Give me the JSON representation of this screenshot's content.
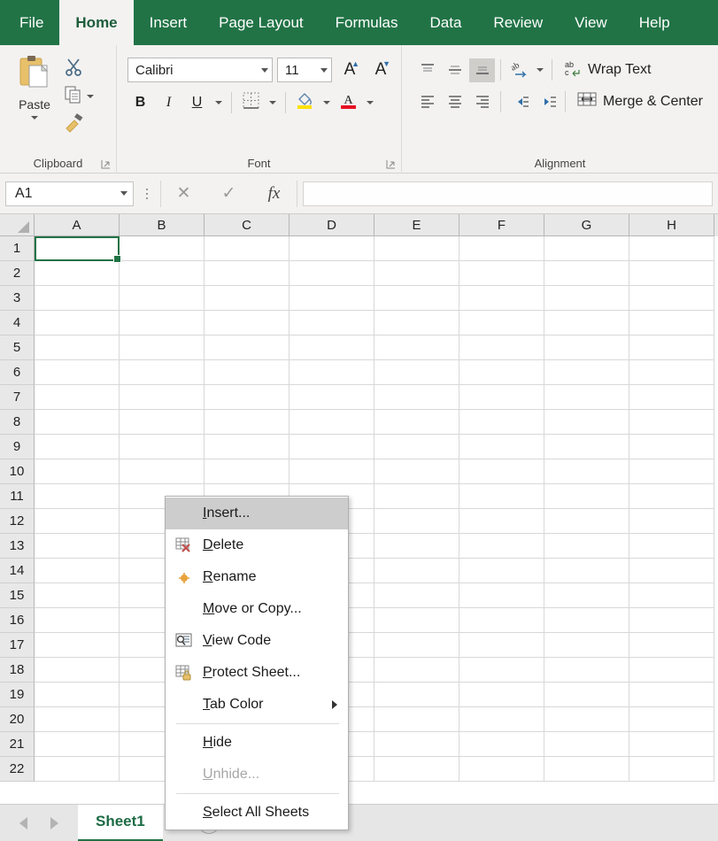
{
  "ribbon": {
    "tabs": [
      {
        "label": "File",
        "active": false
      },
      {
        "label": "Home",
        "active": true
      },
      {
        "label": "Insert",
        "active": false
      },
      {
        "label": "Page Layout",
        "active": false
      },
      {
        "label": "Formulas",
        "active": false
      },
      {
        "label": "Data",
        "active": false
      },
      {
        "label": "Review",
        "active": false
      },
      {
        "label": "View",
        "active": false
      },
      {
        "label": "Help",
        "active": false
      }
    ],
    "groups": {
      "clipboard": {
        "label": "Clipboard",
        "paste_label": "Paste",
        "icons": [
          "paste-clipboard-icon",
          "cut-scissors-icon",
          "copy-icon",
          "format-painter-icon"
        ]
      },
      "font": {
        "label": "Font",
        "font_name": "Calibri",
        "font_size": "11",
        "grow_font": "A",
        "shrink_font": "A",
        "bold": "B",
        "italic": "I",
        "underline": "U"
      },
      "alignment": {
        "label": "Alignment",
        "wrap_text": "Wrap Text",
        "merge_center": "Merge & Center"
      }
    }
  },
  "formula_bar": {
    "name_box": "A1",
    "formula_value": "",
    "cancel_icon": "✕",
    "enter_icon": "✓",
    "fx_label": "fx"
  },
  "grid": {
    "columns": [
      "A",
      "B",
      "C",
      "D",
      "E",
      "F",
      "G",
      "H"
    ],
    "rows": [
      1,
      2,
      3,
      4,
      5,
      6,
      7,
      8,
      9,
      10,
      11,
      12,
      13,
      14,
      15,
      16,
      17,
      18,
      19,
      20,
      21,
      22
    ],
    "selected_cell": "A1",
    "selection_color": "#217346"
  },
  "context_menu": {
    "items": [
      {
        "label": "Insert...",
        "accel": "I",
        "icon": null,
        "highlighted": true,
        "disabled": false,
        "submenu": false,
        "separator_after": false
      },
      {
        "label": "Delete",
        "accel": "D",
        "icon": "delete-sheet-icon",
        "highlighted": false,
        "disabled": false,
        "submenu": false,
        "separator_after": false
      },
      {
        "label": "Rename",
        "accel": "R",
        "icon": "rename-sheet-icon",
        "highlighted": false,
        "disabled": false,
        "submenu": false,
        "separator_after": false
      },
      {
        "label": "Move or Copy...",
        "accel": "M",
        "icon": null,
        "highlighted": false,
        "disabled": false,
        "submenu": false,
        "separator_after": false
      },
      {
        "label": "View Code",
        "accel": "V",
        "icon": "view-code-icon",
        "highlighted": false,
        "disabled": false,
        "submenu": false,
        "separator_after": false
      },
      {
        "label": "Protect Sheet...",
        "accel": "P",
        "icon": "protect-sheet-icon",
        "highlighted": false,
        "disabled": false,
        "submenu": false,
        "separator_after": false
      },
      {
        "label": "Tab Color",
        "accel": "T",
        "icon": null,
        "highlighted": false,
        "disabled": false,
        "submenu": true,
        "separator_after": true
      },
      {
        "label": "Hide",
        "accel": "H",
        "icon": null,
        "highlighted": false,
        "disabled": false,
        "submenu": false,
        "separator_after": false
      },
      {
        "label": "Unhide...",
        "accel": "U",
        "icon": null,
        "highlighted": false,
        "disabled": true,
        "submenu": false,
        "separator_after": true
      },
      {
        "label": "Select All Sheets",
        "accel": "S",
        "icon": null,
        "highlighted": false,
        "disabled": false,
        "submenu": false,
        "separator_after": false
      }
    ]
  },
  "sheet_bar": {
    "tabs": [
      "Sheet1"
    ],
    "add_sheet_label": "+",
    "prev_icon": "nav-prev-icon",
    "next_icon": "nav-next-icon"
  },
  "colors": {
    "ribbon_green": "#217346",
    "ribbon_bg": "#f3f2f1",
    "menu_highlight": "#cdcdcd"
  }
}
